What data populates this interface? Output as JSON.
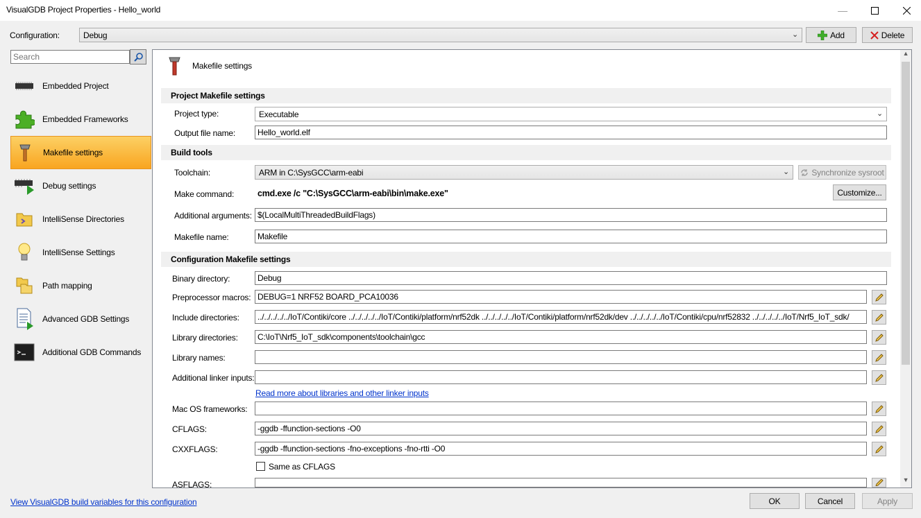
{
  "window": {
    "title": "VisualGDB Project Properties - Hello_world"
  },
  "config": {
    "label": "Configuration:",
    "value": "Debug",
    "add_label": "Add",
    "delete_label": "Delete"
  },
  "search": {
    "placeholder": "Search"
  },
  "sidebar": {
    "items": [
      {
        "label": "Embedded Project",
        "icon": "chip-icon"
      },
      {
        "label": "Embedded Frameworks",
        "icon": "puzzle-icon"
      },
      {
        "label": "Makefile settings",
        "icon": "hammer-icon"
      },
      {
        "label": "Debug settings",
        "icon": "chip-play-icon"
      },
      {
        "label": "IntelliSense Directories",
        "icon": "folder-icon"
      },
      {
        "label": "IntelliSense Settings",
        "icon": "lightbulb-icon"
      },
      {
        "label": "Path mapping",
        "icon": "folders-icon"
      },
      {
        "label": "Advanced GDB Settings",
        "icon": "document-play-icon"
      },
      {
        "label": "Additional GDB Commands",
        "icon": "terminal-icon"
      }
    ],
    "active_index": 2
  },
  "page": {
    "title": "Makefile settings"
  },
  "project_makefile": {
    "header": "Project Makefile settings",
    "project_type_label": "Project type:",
    "project_type": "Executable",
    "output_file_label": "Output file name:",
    "output_file": "Hello_world.elf"
  },
  "build_tools": {
    "header": "Build tools",
    "toolchain_label": "Toolchain:",
    "toolchain": "ARM in C:\\SysGCC\\arm-eabi",
    "sync_label": "Synchronize sysroot",
    "make_label": "Make command:",
    "make": "cmd.exe /c \"C:\\SysGCC\\arm-eabi\\bin\\make.exe\"",
    "customize_label": "Customize...",
    "args_label": "Additional arguments:",
    "args": "$(LocalMultiThreadedBuildFlags)",
    "makefile_label": "Makefile name:",
    "makefile": "Makefile"
  },
  "config_makefile": {
    "header": "Configuration Makefile settings",
    "binary_dir_label": "Binary directory:",
    "binary_dir": "Debug",
    "macros_label": "Preprocessor macros:",
    "macros": "DEBUG=1 NRF52 BOARD_PCA10036",
    "include_label": "Include directories:",
    "include": "../../../../../IoT/Contiki/core ../../../../../IoT/Contiki/platform/nrf52dk ../../../../../IoT/Contiki/platform/nrf52dk/dev ../../../../../IoT/Contiki/cpu/nrf52832 ../../../../../IoT/Nrf5_IoT_sdk/",
    "libdir_label": "Library directories:",
    "libdir": "C:\\IoT\\Nrf5_IoT_sdk\\components\\toolchain\\gcc",
    "libnames_label": "Library names:",
    "libnames": "",
    "linker_label": "Additional linker inputs:",
    "linker": "",
    "linker_link": "Read more about libraries and other linker inputs",
    "macos_label": "Mac OS frameworks:",
    "macos": "",
    "cflags_label": "CFLAGS:",
    "cflags": "-ggdb -ffunction-sections -O0",
    "cxxflags_label": "CXXFLAGS:",
    "cxxflags": "-ggdb -ffunction-sections -fno-exceptions -fno-rtti -O0",
    "same_label": "Same as CFLAGS",
    "asflags_label": "ASFLAGS:",
    "asflags": ""
  },
  "footer": {
    "link": "View VisualGDB build variables for this configuration",
    "ok": "OK",
    "cancel": "Cancel",
    "apply": "Apply"
  }
}
